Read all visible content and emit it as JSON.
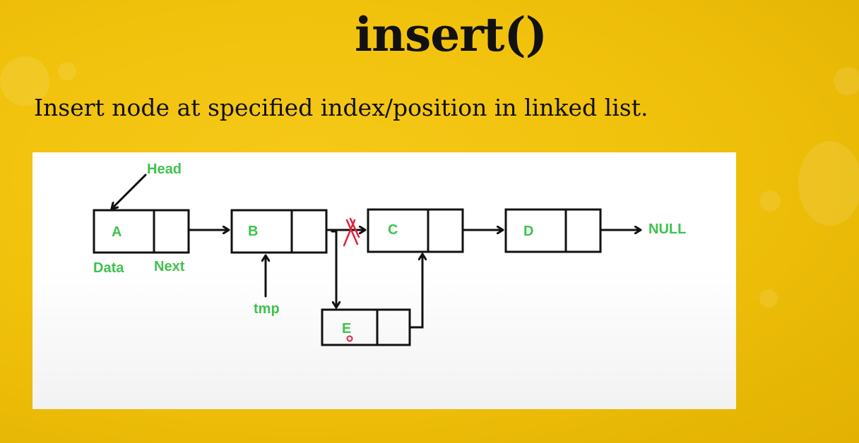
{
  "slide": {
    "title": "insert()",
    "subtitle": "Insert node at specified index/position in linked list."
  },
  "diagram": {
    "head_label": "Head",
    "data_label": "Data",
    "next_label": "Next",
    "tmp_label": "tmp",
    "null_label": "NULL",
    "nodes": [
      {
        "id": "A",
        "label": "A"
      },
      {
        "id": "B",
        "label": "B"
      },
      {
        "id": "C",
        "label": "C"
      },
      {
        "id": "D",
        "label": "D"
      },
      {
        "id": "E",
        "label": "E"
      }
    ],
    "colors": {
      "label": "#3fc24e",
      "removed_link": "#e0203a",
      "stroke": "#111111",
      "background": "#f1c20c"
    }
  }
}
